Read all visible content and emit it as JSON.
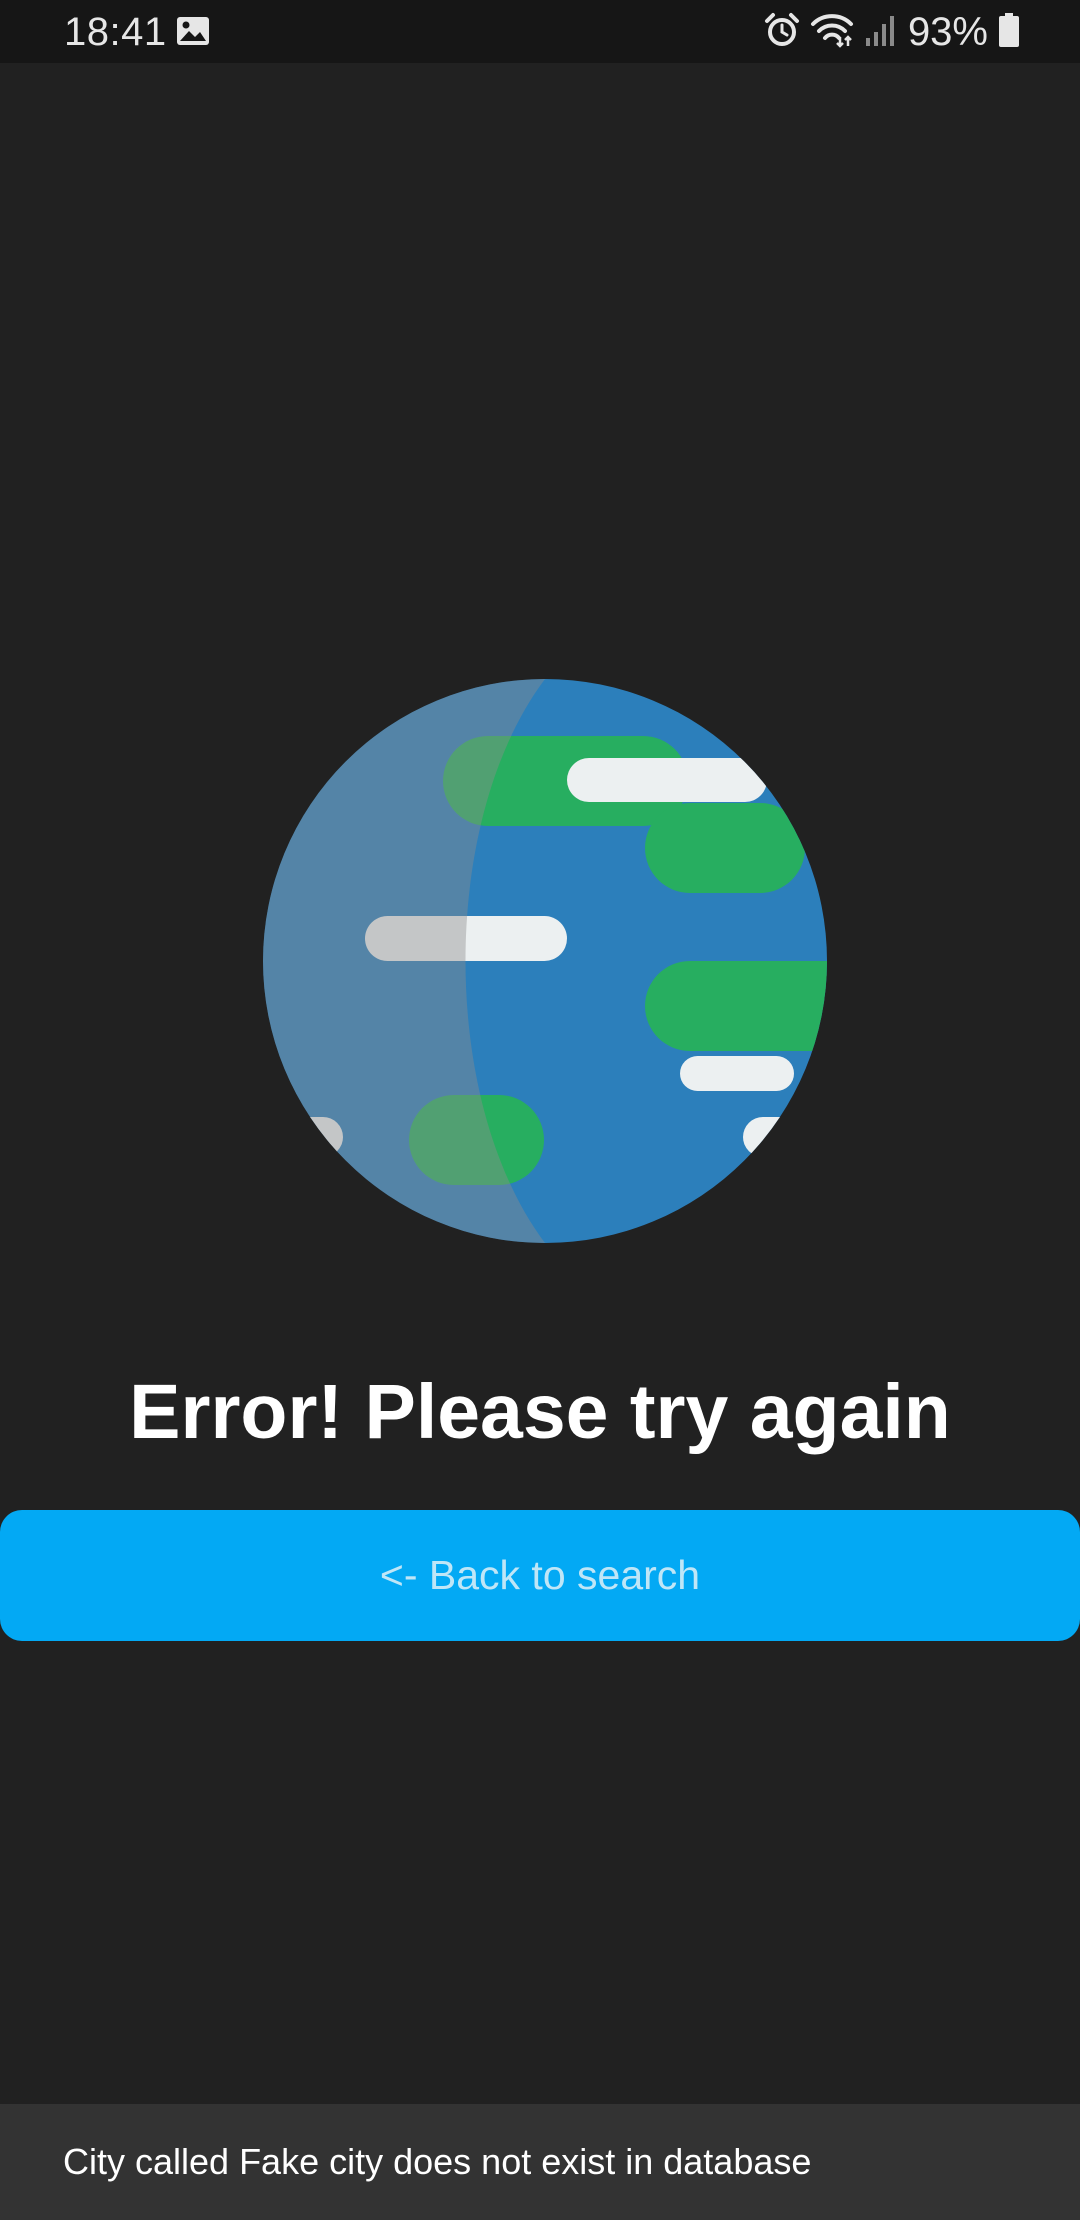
{
  "status_bar": {
    "time": "18:41",
    "battery_percent": "93%",
    "icons": [
      "image-icon",
      "alarm-icon",
      "wifi-icon",
      "signal-icon",
      "battery-icon"
    ]
  },
  "main": {
    "illustration": "globe-illustration",
    "error_title": "Error! Please try again",
    "back_button_label": "<- Back to search"
  },
  "snackbar": {
    "message": "City called Fake city does not exist in database"
  },
  "colors": {
    "background": "#212121",
    "status_bar": "#161616",
    "accent_button": "#03a9f4",
    "button_text": "#bfe6f7",
    "snackbar": "#333333",
    "globe_ocean": "#2c7fbb",
    "globe_land": "#27ae60",
    "globe_cloud": "#ecf0f1"
  }
}
